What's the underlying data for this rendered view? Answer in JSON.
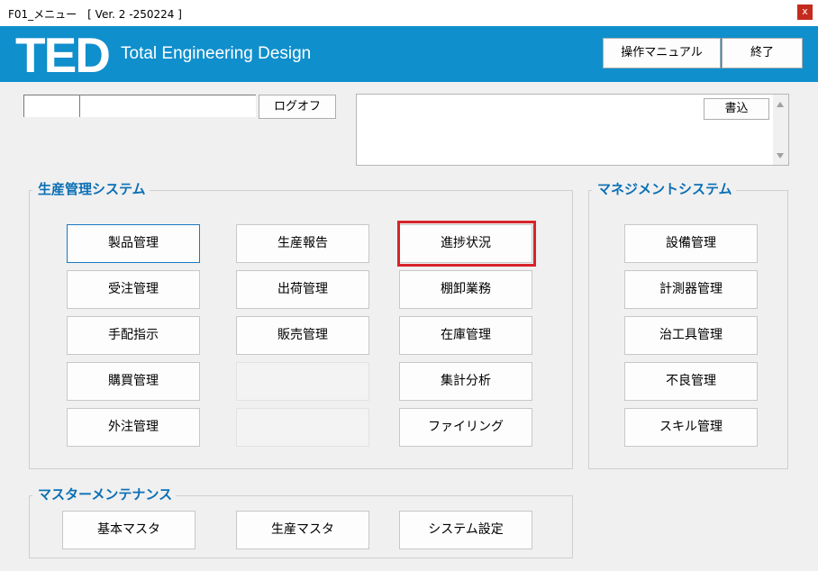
{
  "window": {
    "title": "F01_メニュー　[ Ver. 2 -250224 ]",
    "close_label": "x"
  },
  "header": {
    "logo": "TED",
    "tagline": "Total Engineering Design",
    "manual_label": "操作マニュアル",
    "exit_label": "終了"
  },
  "login": {
    "user_id_value": "",
    "user_name_value": "",
    "logoff_label": "ログオフ"
  },
  "memo": {
    "text": "",
    "write_label": "書込"
  },
  "production": {
    "title": "生産管理システム",
    "buttons": [
      "製品管理",
      "生産報告",
      "進捗状況",
      "受注管理",
      "出荷管理",
      "棚卸業務",
      "手配指示",
      "販売管理",
      "在庫管理",
      "購買管理",
      "",
      "集計分析",
      "外注管理",
      "",
      "ファイリング"
    ]
  },
  "management": {
    "title": "マネジメントシステム",
    "buttons": [
      "設備管理",
      "計測器管理",
      "治工具管理",
      "不良管理",
      "スキル管理"
    ]
  },
  "master": {
    "title": "マスターメンテナンス",
    "buttons": [
      "基本マスタ",
      "生産マスタ",
      "システム設定"
    ]
  },
  "colors": {
    "header_bg": "#0f8fcc",
    "group_title": "#0a6fb5",
    "highlight": "#d9232a",
    "close_bg": "#c42b1c"
  }
}
